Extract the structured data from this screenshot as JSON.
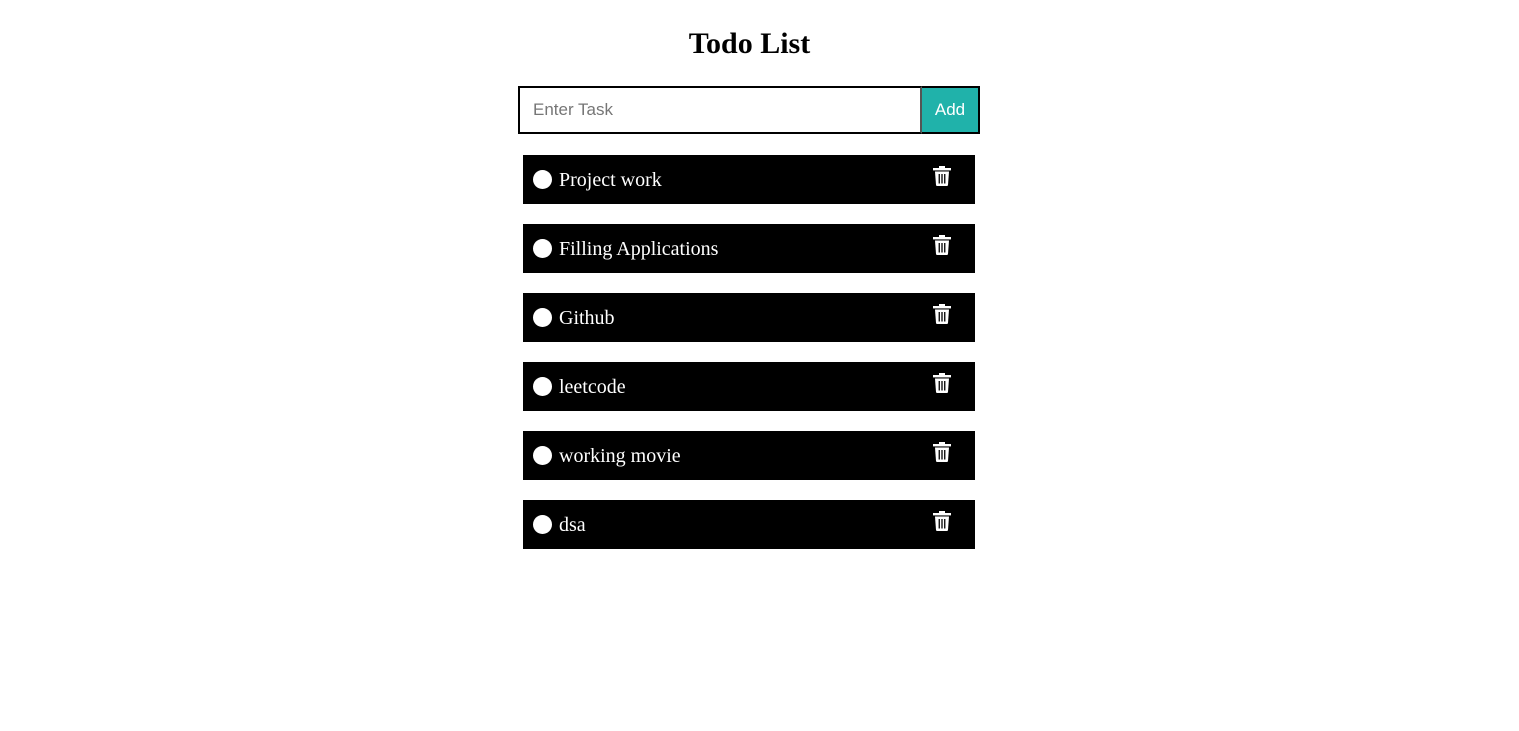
{
  "header": {
    "title": "Todo List"
  },
  "input": {
    "placeholder": "Enter Task",
    "value": ""
  },
  "add_button": {
    "label": "Add",
    "color": "#20b2aa"
  },
  "tasks": [
    {
      "label": "Project work",
      "icon": "trash-icon"
    },
    {
      "label": "Filling Applications",
      "icon": "trash-icon"
    },
    {
      "label": "Github",
      "icon": "trash-icon"
    },
    {
      "label": "leetcode",
      "icon": "trash-icon"
    },
    {
      "label": "working movie",
      "icon": "trash-icon"
    },
    {
      "label": "dsa",
      "icon": "trash-icon"
    }
  ],
  "colors": {
    "task_background": "#000000",
    "task_text": "#ffffff",
    "accent": "#20b2aa"
  }
}
